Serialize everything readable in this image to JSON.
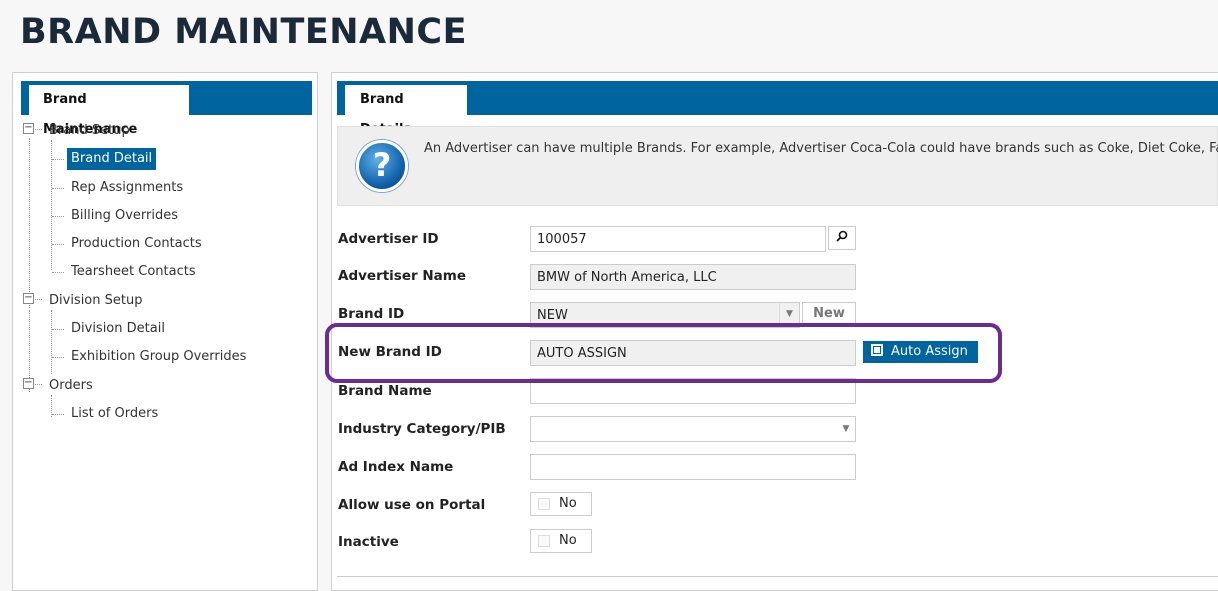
{
  "app": {
    "title": "BRAND MAINTENANCE"
  },
  "left_panel": {
    "tab_label": "Brand Maintenance",
    "tree": [
      {
        "label": "Brand Setup",
        "level": 0,
        "toggle": "−"
      },
      {
        "label": "Brand Detail",
        "level": 1,
        "selected": true
      },
      {
        "label": "Rep Assignments",
        "level": 1
      },
      {
        "label": "Billing Overrides",
        "level": 1
      },
      {
        "label": "Production Contacts",
        "level": 1
      },
      {
        "label": "Tearsheet Contacts",
        "level": 1
      },
      {
        "label": "Division Setup",
        "level": 0,
        "toggle": "−"
      },
      {
        "label": "Division Detail",
        "level": 1
      },
      {
        "label": "Exhibition Group Overrides",
        "level": 1
      },
      {
        "label": "Orders",
        "level": 0,
        "toggle": "−"
      },
      {
        "label": "List of Orders",
        "level": 1
      }
    ]
  },
  "right_panel": {
    "tab_label": "Brand Details",
    "info_text": "An Advertiser can have multiple Brands. For example, Advertiser Coca-Cola could have brands such as Coke, Diet Coke, Fanta. Ad",
    "info_icon": "question-icon",
    "form": {
      "advertiser_id": {
        "label": "Advertiser ID",
        "value": "100057",
        "lookup_icon": "search-icon"
      },
      "advertiser_name": {
        "label": "Advertiser Name",
        "value": "BMW of North America, LLC"
      },
      "brand_id": {
        "label": "Brand ID",
        "value": "NEW",
        "new_label": "New"
      },
      "new_brand_id": {
        "label": "New Brand ID",
        "value": "AUTO ASSIGN",
        "auto_assign_label": "Auto Assign"
      },
      "brand_name": {
        "label": "Brand Name",
        "value": ""
      },
      "industry_category": {
        "label": "Industry Category/PIB",
        "value": ""
      },
      "ad_index_name": {
        "label": "Ad Index Name",
        "value": ""
      },
      "allow_portal": {
        "label": "Allow use on Portal",
        "value": "No"
      },
      "inactive": {
        "label": "Inactive",
        "value": "No"
      }
    }
  },
  "colors": {
    "accent": "#00659e",
    "highlight": "#6a2c91"
  }
}
